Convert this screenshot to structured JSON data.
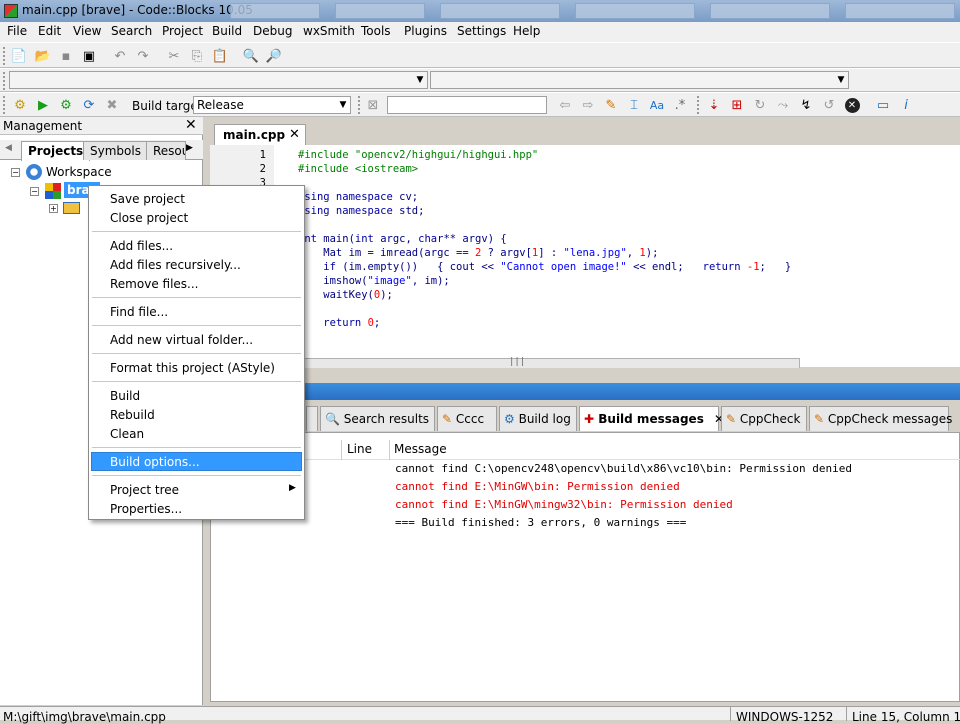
{
  "window": {
    "title": "main.cpp [brave] - Code::Blocks 10.05"
  },
  "menu": [
    "File",
    "Edit",
    "View",
    "Search",
    "Project",
    "Build",
    "Debug",
    "wxSmith",
    "Tools",
    "Plugins",
    "Settings",
    "Help"
  ],
  "toolbar": {
    "build_target_label": "Build target:",
    "build_target_value": "Release"
  },
  "management": {
    "title": "Management",
    "tabs": [
      "Projects",
      "Symbols",
      "Resou"
    ],
    "tree": {
      "workspace": "Workspace",
      "project": "brav"
    }
  },
  "editor": {
    "tab": "main.cpp",
    "lines": [
      {
        "n": "1",
        "html": "<span class='pp'>#include \"opencv2/highgui/highgui.hpp\"</span>"
      },
      {
        "n": "2",
        "html": "<span class='pp'>#include &lt;iostream&gt;</span>"
      },
      {
        "n": "3",
        "html": ""
      },
      {
        "n": "",
        "html": "<span class='kw'>using namespace</span> cv;"
      },
      {
        "n": "",
        "html": "<span class='kw'>using namespace</span> std;"
      },
      {
        "n": "",
        "html": ""
      },
      {
        "n": "",
        "html": "<span class='kw'>int</span> main(<span class='kw'>int</span> argc, <span class='kw'>char</span>** argv) {"
      },
      {
        "n": "",
        "html": "    Mat im = imread(argc == <span class='num'>2</span> ? argv[<span class='num'>1</span>] : <span class='str'>\"lena.jpg\"</span>, <span class='num'>1</span>);"
      },
      {
        "n": "",
        "html": "    <span class='kw'>if</span> (im.empty())   { cout &lt;&lt; <span class='str'>\"Cannot open image!\"</span> &lt;&lt; endl;   <span class='kw'>return</span> <span class='num'>-1</span>;   }"
      },
      {
        "n": "",
        "html": "    imshow(<span class='str'>\"image\"</span>, im);"
      },
      {
        "n": "",
        "html": "    waitKey(<span class='num'>0</span>);"
      },
      {
        "n": "",
        "html": ""
      },
      {
        "n": "",
        "html": "    <span class='kw'>return</span> <span class='num'>0</span>;"
      },
      {
        "n": "",
        "html": "}"
      }
    ]
  },
  "logs": {
    "tabs": [
      "Search results",
      "Cccc",
      "Build log",
      "Build messages",
      "CppCheck",
      "CppCheck messages"
    ],
    "active_tab": "Build messages",
    "columns": [
      "Line",
      "Message"
    ],
    "messages": [
      {
        "text": "cannot find C:\\opencv248\\opencv\\build\\x86\\vc10\\bin: Permission denied",
        "color": "#000000"
      },
      {
        "text": "cannot find E:\\MinGW\\bin: Permission denied",
        "color": "#e00000"
      },
      {
        "text": "cannot find E:\\MinGW\\mingw32\\bin: Permission denied",
        "color": "#e00000"
      },
      {
        "text": "=== Build finished: 3 errors, 0 warnings ===",
        "color": "#000000"
      }
    ]
  },
  "context_menu": {
    "items": [
      "Save project",
      "Close project",
      "Add files...",
      "Add files recursively...",
      "Remove files...",
      "Find file...",
      "Add new virtual folder...",
      "Format this project (AStyle)",
      "Build",
      "Rebuild",
      "Clean",
      "Build options...",
      "Project tree",
      "Properties..."
    ],
    "highlighted": "Build options..."
  },
  "status": {
    "path": "M:\\gift\\img\\brave\\main.cpp",
    "encoding": "WINDOWS-1252",
    "position": "Line 15, Column 1"
  }
}
